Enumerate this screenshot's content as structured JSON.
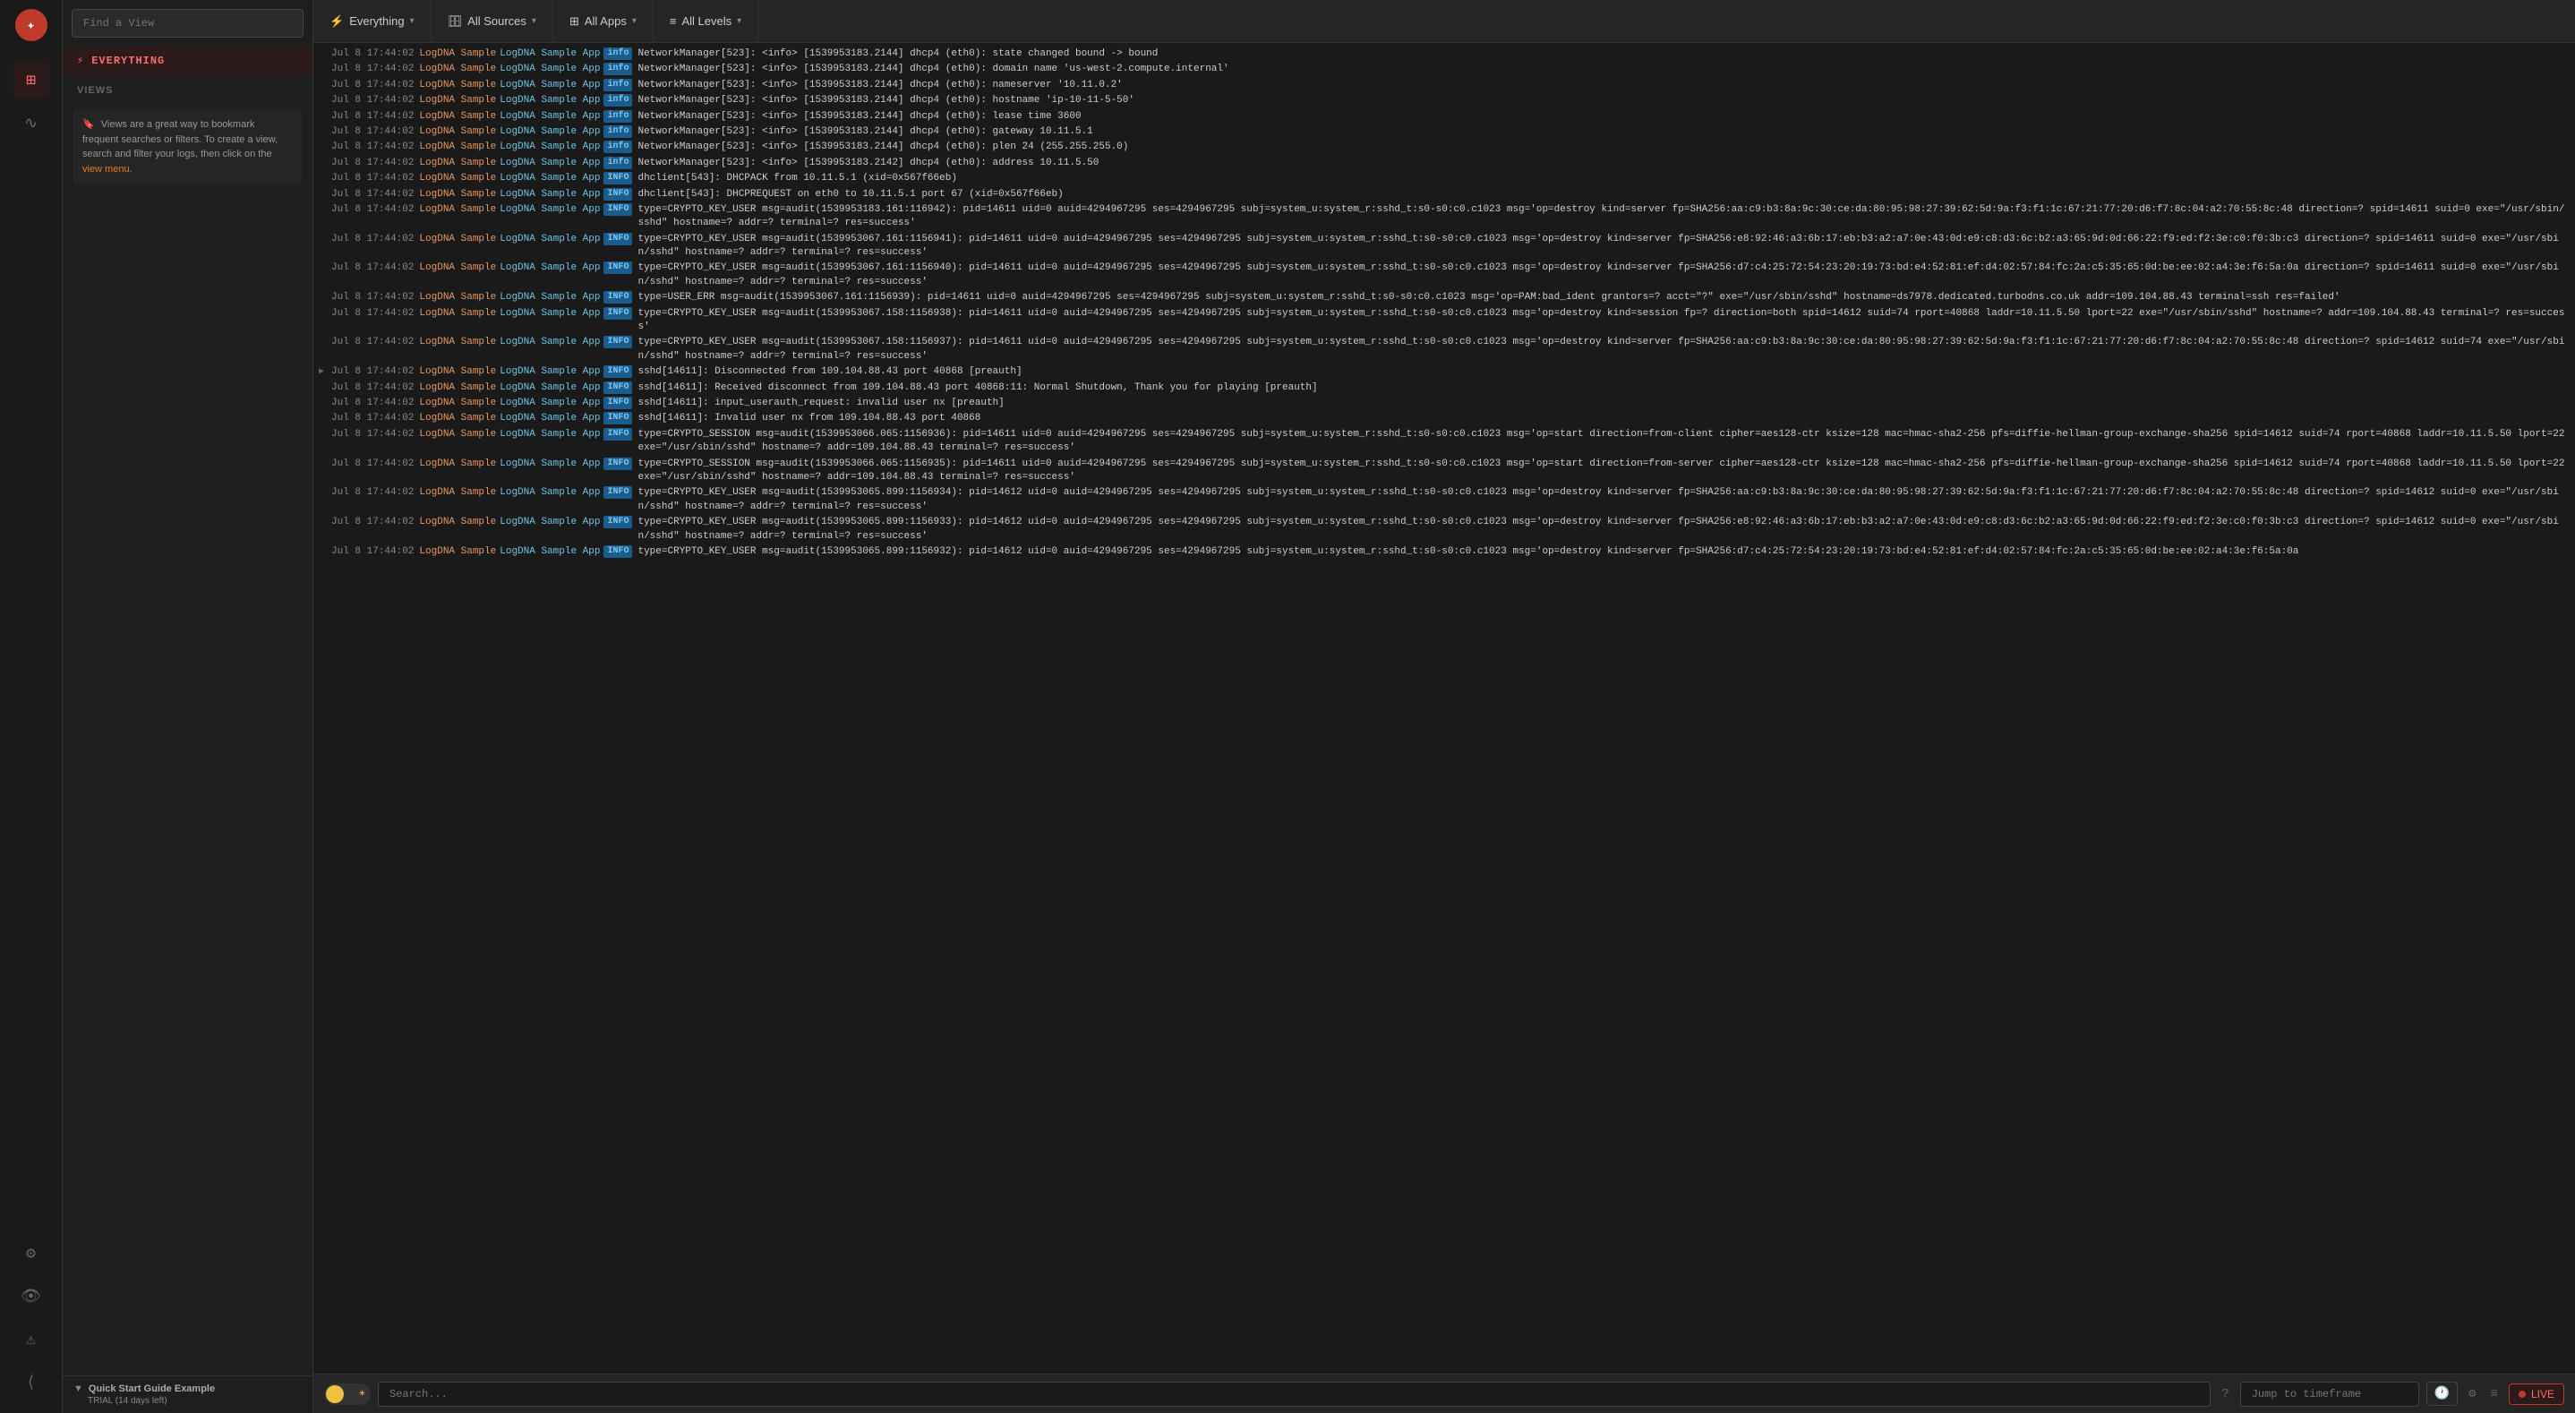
{
  "sidebar": {
    "logo_char": "✦",
    "icons": [
      {
        "name": "layout-icon",
        "glyph": "⊞",
        "active": true
      },
      {
        "name": "pulse-icon",
        "glyph": "∿",
        "active": false
      },
      {
        "name": "settings-icon",
        "glyph": "⚙",
        "active": false
      },
      {
        "name": "eye-icon",
        "glyph": "👁",
        "active": false
      },
      {
        "name": "alert-icon",
        "glyph": "⚠",
        "active": false
      },
      {
        "name": "collapse-icon",
        "glyph": "⟨",
        "active": false
      }
    ]
  },
  "left_panel": {
    "find_view_placeholder": "Find a View",
    "everything_label": "EVERYTHING",
    "views_label": "VIEWS",
    "tip_text": "Views are a great way to bookmark frequent searches or filters. To create a view, search and filter your logs, then click on the",
    "tip_link": "view menu.",
    "quick_start_title": "Quick Start Guide Example",
    "trial_label": "TRIAL (14 days left)"
  },
  "top_bar": {
    "everything_label": "Everything",
    "all_sources_label": "All Sources",
    "all_apps_label": "All Apps",
    "all_levels_label": "All Levels"
  },
  "bottom_bar": {
    "search_placeholder": "Search...",
    "jump_placeholder": "Jump to timeframe",
    "live_label": "LIVE"
  },
  "logs": [
    {
      "timestamp": "Jul 8 17:44:02",
      "source": "LogDNA Sample",
      "app": "LogDNA Sample App",
      "level": "info",
      "message": "NetworkManager[523]: <info>  [1539953183.2144] dhcp4 (eth0): state changed bound -> bound"
    },
    {
      "timestamp": "Jul 8 17:44:02",
      "source": "LogDNA Sample",
      "app": "LogDNA Sample App",
      "level": "info",
      "message": "NetworkManager[523]: <info>  [1539953183.2144] dhcp4 (eth0):   domain name 'us-west-2.compute.internal'"
    },
    {
      "timestamp": "Jul 8 17:44:02",
      "source": "LogDNA Sample",
      "app": "LogDNA Sample App",
      "level": "info",
      "message": "NetworkManager[523]: <info>  [1539953183.2144] dhcp4 (eth0):   nameserver '10.11.0.2'"
    },
    {
      "timestamp": "Jul 8 17:44:02",
      "source": "LogDNA Sample",
      "app": "LogDNA Sample App",
      "level": "info",
      "message": "NetworkManager[523]: <info>  [1539953183.2144] dhcp4 (eth0):   hostname 'ip-10-11-5-50'"
    },
    {
      "timestamp": "Jul 8 17:44:02",
      "source": "LogDNA Sample",
      "app": "LogDNA Sample App",
      "level": "info",
      "message": "NetworkManager[523]: <info>  [1539953183.2144] dhcp4 (eth0):   lease time 3600"
    },
    {
      "timestamp": "Jul 8 17:44:02",
      "source": "LogDNA Sample",
      "app": "LogDNA Sample App",
      "level": "info",
      "message": "NetworkManager[523]: <info>  [1539953183.2144] dhcp4 (eth0):   gateway 10.11.5.1"
    },
    {
      "timestamp": "Jul 8 17:44:02",
      "source": "LogDNA Sample",
      "app": "LogDNA Sample App",
      "level": "info",
      "message": "NetworkManager[523]: <info>  [1539953183.2144] dhcp4 (eth0):   plen 24 (255.255.255.0)"
    },
    {
      "timestamp": "Jul 8 17:44:02",
      "source": "LogDNA Sample",
      "app": "LogDNA Sample App",
      "level": "info",
      "message": "NetworkManager[523]: <info>  [1539953183.2142] dhcp4 (eth0):   address 10.11.5.50"
    },
    {
      "timestamp": "Jul 8 17:44:02",
      "source": "LogDNA Sample",
      "app": "LogDNA Sample App",
      "level": "INFO",
      "message": "dhclient[543]: DHCPACK from 10.11.5.1 (xid=0x567f66eb)"
    },
    {
      "timestamp": "Jul 8 17:44:02",
      "source": "LogDNA Sample",
      "app": "LogDNA Sample App",
      "level": "INFO",
      "message": "dhclient[543]: DHCPREQUEST on eth0 to 10.11.5.1 port 67 (xid=0x567f66eb)"
    },
    {
      "timestamp": "Jul 8 17:44:02",
      "source": "LogDNA Sample",
      "app": "LogDNA Sample App",
      "level": "INFO",
      "message": "type=CRYPTO_KEY_USER msg=audit(1539953183.161:116942): pid=14611 uid=0 auid=4294967295 ses=4294967295 subj=system_u:system_r:sshd_t:s0-s0:c0.c1023 msg='op=destroy kind=server fp=SHA256:aa:c9:b3:8a:9c:30:ce:da:80:95:98:27:39:62:5d:9a:f3:f1:1c:67:21:77:20:d6:f7:8c:04:a2:70:55:8c:48 direction=? spid=14611 suid=0  exe=\"/usr/sbin/sshd\" hostname=? addr=? terminal=? res=success'"
    },
    {
      "timestamp": "Jul 8 17:44:02",
      "source": "LogDNA Sample",
      "app": "LogDNA Sample App",
      "level": "INFO",
      "message": "type=CRYPTO_KEY_USER msg=audit(1539953067.161:1156941): pid=14611 uid=0 auid=4294967295 ses=4294967295 subj=system_u:system_r:sshd_t:s0-s0:c0.c1023 msg='op=destroy kind=server fp=SHA256:e8:92:46:a3:6b:17:eb:b3:a2:a7:0e:43:0d:e9:c8:d3:6c:b2:a3:65:9d:0d:66:22:f9:ed:f2:3e:c0:f0:3b:c3 direction=? spid=14611 suid=0  exe=\"/usr/sbin/sshd\" hostname=? addr=? terminal=? res=success'"
    },
    {
      "timestamp": "Jul 8 17:44:02",
      "source": "LogDNA Sample",
      "app": "LogDNA Sample App",
      "level": "INFO",
      "message": "type=CRYPTO_KEY_USER msg=audit(1539953067.161:1156940): pid=14611 uid=0 auid=4294967295 ses=4294967295 subj=system_u:system_r:sshd_t:s0-s0:c0.c1023 msg='op=destroy kind=server fp=SHA256:d7:c4:25:72:54:23:20:19:73:bd:e4:52:81:ef:d4:02:57:84:fc:2a:c5:35:65:0d:be:ee:02:a4:3e:f6:5a:0a direction=? spid=14611 suid=0  exe=\"/usr/sbin/sshd\" hostname=? addr=? terminal=? res=success'"
    },
    {
      "timestamp": "Jul 8 17:44:02",
      "source": "LogDNA Sample",
      "app": "LogDNA Sample App",
      "level": "INFO",
      "message": "type=USER_ERR msg=audit(1539953067.161:1156939): pid=14611 uid=0 auid=4294967295 ses=4294967295 subj=system_u:system_r:sshd_t:s0-s0:c0.c1023 msg='op=PAM:bad_ident grantors=? acct=\"?\" exe=\"/usr/sbin/sshd\" hostname=ds7978.dedicated.turbodns.co.uk addr=109.104.88.43 terminal=ssh res=failed'"
    },
    {
      "timestamp": "Jul 8 17:44:02",
      "source": "LogDNA Sample",
      "app": "LogDNA Sample App",
      "level": "INFO",
      "message": "type=CRYPTO_KEY_USER msg=audit(1539953067.158:1156938): pid=14611 uid=0 auid=4294967295 ses=4294967295 subj=system_u:system_r:sshd_t:s0-s0:c0.c1023 msg='op=destroy kind=session fp=? direction=both spid=14612 suid=74 rport=40868 laddr=10.11.5.50 lport=22  exe=\"/usr/sbin/sshd\" hostname=? addr=109.104.88.43 terminal=? res=success'"
    },
    {
      "timestamp": "Jul 8 17:44:02",
      "source": "LogDNA Sample",
      "app": "LogDNA Sample App",
      "level": "INFO",
      "message": "type=CRYPTO_KEY_USER msg=audit(1539953067.158:1156937): pid=14611 uid=0 auid=4294967295 ses=4294967295 subj=system_u:system_r:sshd_t:s0-s0:c0.c1023 msg='op=destroy kind=server fp=SHA256:aa:c9:b3:8a:9c:30:ce:da:80:95:98:27:39:62:5d:9a:f3:f1:1c:67:21:77:20:d6:f7:8c:04:a2:70:55:8c:48 direction=? spid=14612 suid=74  exe=\"/usr/sbin/sshd\" hostname=? addr=? terminal=? res=success'"
    },
    {
      "timestamp": "Jul 8 17:44:02",
      "source": "LogDNA Sample",
      "app": "LogDNA Sample App",
      "level": "INFO",
      "message": "sshd[14611]: Disconnected from 109.104.88.43 port 40868 [preauth]",
      "has_arrow": true
    },
    {
      "timestamp": "Jul 8 17:44:02",
      "source": "LogDNA Sample",
      "app": "LogDNA Sample App",
      "level": "INFO",
      "message": "sshd[14611]: Received disconnect from 109.104.88.43 port 40868:11: Normal Shutdown, Thank you for playing [preauth]"
    },
    {
      "timestamp": "Jul 8 17:44:02",
      "source": "LogDNA Sample",
      "app": "LogDNA Sample App",
      "level": "INFO",
      "message": "sshd[14611]: input_userauth_request: invalid user nx [preauth]"
    },
    {
      "timestamp": "Jul 8 17:44:02",
      "source": "LogDNA Sample",
      "app": "LogDNA Sample App",
      "level": "INFO",
      "message": "sshd[14611]: Invalid user nx from 109.104.88.43 port 40868"
    },
    {
      "timestamp": "Jul 8 17:44:02",
      "source": "LogDNA Sample",
      "app": "LogDNA Sample App",
      "level": "INFO",
      "message": "type=CRYPTO_SESSION msg=audit(1539953066.065:1156936): pid=14611 uid=0 auid=4294967295 ses=4294967295 subj=system_u:system_r:sshd_t:s0-s0:c0.c1023 msg='op=start direction=from-client cipher=aes128-ctr ksize=128 mac=hmac-sha2-256 pfs=diffie-hellman-group-exchange-sha256 spid=14612 suid=74 rport=40868 laddr=10.11.5.50 lport=22  exe=\"/usr/sbin/sshd\" hostname=? addr=109.104.88.43 terminal=? res=success'"
    },
    {
      "timestamp": "Jul 8 17:44:02",
      "source": "LogDNA Sample",
      "app": "LogDNA Sample App",
      "level": "INFO",
      "message": "type=CRYPTO_SESSION msg=audit(1539953066.065:1156935): pid=14611 uid=0 auid=4294967295 ses=4294967295 subj=system_u:system_r:sshd_t:s0-s0:c0.c1023 msg='op=start direction=from-server cipher=aes128-ctr ksize=128 mac=hmac-sha2-256 pfs=diffie-hellman-group-exchange-sha256 spid=14612 suid=74 rport=40868 laddr=10.11.5.50 lport=22  exe=\"/usr/sbin/sshd\" hostname=? addr=109.104.88.43 terminal=? res=success'"
    },
    {
      "timestamp": "Jul 8 17:44:02",
      "source": "LogDNA Sample",
      "app": "LogDNA Sample App",
      "level": "INFO",
      "message": "type=CRYPTO_KEY_USER msg=audit(1539953065.899:1156934): pid=14612 uid=0 auid=4294967295 ses=4294967295 subj=system_u:system_r:sshd_t:s0-s0:c0.c1023 msg='op=destroy kind=server fp=SHA256:aa:c9:b3:8a:9c:30:ce:da:80:95:98:27:39:62:5d:9a:f3:f1:1c:67:21:77:20:d6:f7:8c:04:a2:70:55:8c:48 direction=? spid=14612 suid=0  exe=\"/usr/sbin/sshd\" hostname=? addr=? terminal=? res=success'"
    },
    {
      "timestamp": "Jul 8 17:44:02",
      "source": "LogDNA Sample",
      "app": "LogDNA Sample App",
      "level": "INFO",
      "message": "type=CRYPTO_KEY_USER msg=audit(1539953065.899:1156933): pid=14612 uid=0 auid=4294967295 ses=4294967295 subj=system_u:system_r:sshd_t:s0-s0:c0.c1023 msg='op=destroy kind=server fp=SHA256:e8:92:46:a3:6b:17:eb:b3:a2:a7:0e:43:0d:e9:c8:d3:6c:b2:a3:65:9d:0d:66:22:f9:ed:f2:3e:c0:f0:3b:c3 direction=? spid=14612 suid=0  exe=\"/usr/sbin/sshd\" hostname=? addr=? terminal=? res=success'"
    },
    {
      "timestamp": "Jul 8 17:44:02",
      "source": "LogDNA Sample",
      "app": "LogDNA Sample App",
      "level": "INFO",
      "message": "type=CRYPTO_KEY_USER msg=audit(1539953065.899:1156932): pid=14612 uid=0 auid=4294967295 ses=4294967295 subj=system_u:system_r:sshd_t:s0-s0:c0.c1023 msg='op=destroy kind=server fp=SHA256:d7:c4:25:72:54:23:20:19:73:bd:e4:52:81:ef:d4:02:57:84:fc:2a:c5:35:65:0d:be:ee:02:a4:3e:f6:5a:0a"
    }
  ]
}
